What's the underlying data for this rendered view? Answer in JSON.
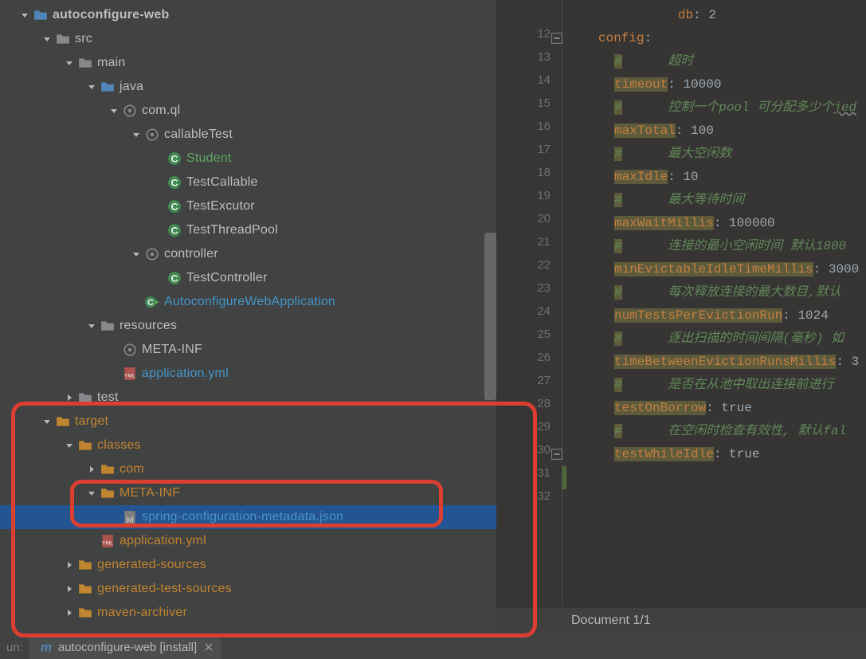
{
  "project": {
    "name": "autoconfigure-web",
    "tree": [
      {
        "d": 0,
        "open": true,
        "kind": "folder-b",
        "label": "autoconfigure-web",
        "style": "bold",
        "color": "normal"
      },
      {
        "d": 1,
        "open": true,
        "kind": "folder",
        "label": "src",
        "color": "normal"
      },
      {
        "d": 2,
        "open": true,
        "kind": "folder",
        "label": "main",
        "color": "normal"
      },
      {
        "d": 3,
        "open": true,
        "kind": "folder-b",
        "label": "java",
        "color": "normal"
      },
      {
        "d": 4,
        "open": true,
        "kind": "package",
        "label": "com.ql",
        "color": "normal"
      },
      {
        "d": 5,
        "open": true,
        "kind": "package",
        "label": "callableTest",
        "color": "normal"
      },
      {
        "d": 6,
        "leaf": true,
        "kind": "class",
        "label": "Student",
        "color": "green"
      },
      {
        "d": 6,
        "leaf": true,
        "kind": "class",
        "label": "TestCallable",
        "color": "normal"
      },
      {
        "d": 6,
        "leaf": true,
        "kind": "class",
        "label": "TestExcutor",
        "color": "normal"
      },
      {
        "d": 6,
        "leaf": true,
        "kind": "class",
        "label": "TestThreadPool",
        "color": "normal"
      },
      {
        "d": 5,
        "open": true,
        "kind": "package",
        "label": "controller",
        "color": "normal"
      },
      {
        "d": 6,
        "leaf": true,
        "kind": "class",
        "label": "TestController",
        "color": "normal"
      },
      {
        "d": 5,
        "leaf": true,
        "kind": "class-run",
        "label": "AutoconfigureWebApplication",
        "color": "blue"
      },
      {
        "d": 3,
        "open": true,
        "kind": "folder",
        "label": "resources",
        "color": "normal"
      },
      {
        "d": 4,
        "leaf": true,
        "kind": "package",
        "label": "META-INF",
        "color": "normal"
      },
      {
        "d": 4,
        "leaf": true,
        "kind": "yml",
        "label": "application.yml",
        "color": "blue"
      },
      {
        "d": 2,
        "open": false,
        "kind": "folder",
        "label": "test",
        "color": "normal"
      },
      {
        "d": 1,
        "open": true,
        "kind": "folder-o",
        "label": "target",
        "color": "orange"
      },
      {
        "d": 2,
        "open": true,
        "kind": "folder-o",
        "label": "classes",
        "color": "orange"
      },
      {
        "d": 3,
        "open": false,
        "kind": "folder-o",
        "label": "com",
        "color": "orange"
      },
      {
        "d": 3,
        "open": true,
        "kind": "folder-o",
        "label": "META-INF",
        "color": "orange"
      },
      {
        "d": 4,
        "leaf": true,
        "kind": "json",
        "label": "spring-configuration-metadata.json",
        "color": "blue",
        "sel": true
      },
      {
        "d": 3,
        "leaf": true,
        "kind": "yml",
        "label": "application.yml",
        "color": "orange"
      },
      {
        "d": 2,
        "open": false,
        "kind": "folder-o",
        "label": "generated-sources",
        "color": "orange"
      },
      {
        "d": 2,
        "open": false,
        "kind": "folder-o",
        "label": "generated-test-sources",
        "color": "orange"
      },
      {
        "d": 2,
        "open": false,
        "kind": "folder-o",
        "label": "maven-archiver",
        "color": "orange"
      }
    ]
  },
  "editor": {
    "first_line_no": 12,
    "gutter_icons": [
      {
        "line": 12,
        "kind": "collapse"
      },
      {
        "line": 30,
        "kind": "collapse"
      }
    ],
    "lines": [
      {
        "n": 0,
        "indent": 14,
        "tokens": [
          [
            "db",
            "key"
          ],
          [
            ": ",
            "val"
          ],
          [
            "2",
            "val"
          ]
        ],
        "partial_top": true
      },
      {
        "n": 12,
        "indent": 4,
        "tokens": [
          [
            "config",
            "key"
          ],
          [
            ":",
            "val"
          ]
        ]
      },
      {
        "n": 13,
        "indent": 6,
        "tokens": [
          [
            "#",
            "cmt-hi"
          ],
          [
            "      ",
            "cmt"
          ],
          [
            "超时",
            "cmt2"
          ]
        ]
      },
      {
        "n": 14,
        "indent": 6,
        "tokens": [
          [
            "timeout",
            "key-hi"
          ],
          [
            ": ",
            "val"
          ],
          [
            "10000",
            "val"
          ]
        ]
      },
      {
        "n": 15,
        "indent": 6,
        "tokens": [
          [
            "#",
            "cmt-hi"
          ],
          [
            "      ",
            "cmt"
          ],
          [
            "控制一个pool 可分配多少个",
            "cmt2"
          ],
          [
            "jed",
            "cmt-ul"
          ]
        ]
      },
      {
        "n": 16,
        "indent": 6,
        "tokens": [
          [
            "maxTotal",
            "key-hi"
          ],
          [
            ": ",
            "val"
          ],
          [
            "100",
            "val"
          ]
        ]
      },
      {
        "n": 17,
        "indent": 6,
        "tokens": [
          [
            "#",
            "cmt-hi"
          ],
          [
            "      ",
            "cmt"
          ],
          [
            "最大空闲数",
            "cmt2"
          ]
        ]
      },
      {
        "n": 18,
        "indent": 6,
        "tokens": [
          [
            "maxIdle",
            "key-hi"
          ],
          [
            ": ",
            "val"
          ],
          [
            "10",
            "val"
          ]
        ]
      },
      {
        "n": 19,
        "indent": 6,
        "tokens": [
          [
            "#",
            "cmt-hi"
          ],
          [
            "      ",
            "cmt"
          ],
          [
            "最大等待时间",
            "cmt2"
          ]
        ]
      },
      {
        "n": 20,
        "indent": 6,
        "tokens": [
          [
            "maxWaitMillis",
            "key-hi"
          ],
          [
            ": ",
            "val"
          ],
          [
            "100000",
            "val"
          ]
        ]
      },
      {
        "n": 21,
        "indent": 6,
        "tokens": [
          [
            "#",
            "cmt-hi"
          ],
          [
            "      ",
            "cmt"
          ],
          [
            "连接的最小空闲时间 默认1800",
            "cmt2"
          ]
        ]
      },
      {
        "n": 22,
        "indent": 6,
        "tokens": [
          [
            "minEvictableIdleTimeMillis",
            "key-hi"
          ],
          [
            ": ",
            "val"
          ],
          [
            "3000",
            "val"
          ]
        ]
      },
      {
        "n": 23,
        "indent": 6,
        "tokens": [
          [
            "#",
            "cmt-hi"
          ],
          [
            "      ",
            "cmt"
          ],
          [
            "每次释放连接的最大数目,默认",
            "cmt2"
          ]
        ]
      },
      {
        "n": 24,
        "indent": 6,
        "tokens": [
          [
            "numTestsPerEvictionRun",
            "key-hi"
          ],
          [
            ": ",
            "val"
          ],
          [
            "1024",
            "val"
          ]
        ]
      },
      {
        "n": 25,
        "indent": 6,
        "tokens": [
          [
            "#",
            "cmt-hi"
          ],
          [
            "      ",
            "cmt"
          ],
          [
            "逐出扫描的时间间隔(毫秒) 如",
            "cmt2"
          ]
        ]
      },
      {
        "n": 26,
        "indent": 6,
        "tokens": [
          [
            "timeBetweenEvictionRunsMillis",
            "key-hi"
          ],
          [
            ": ",
            "val"
          ],
          [
            "3",
            "val"
          ]
        ]
      },
      {
        "n": 27,
        "indent": 6,
        "tokens": [
          [
            "#",
            "cmt-hi"
          ],
          [
            "      ",
            "cmt"
          ],
          [
            "是否在从池中取出连接前进行",
            "cmt2"
          ]
        ]
      },
      {
        "n": 28,
        "indent": 6,
        "tokens": [
          [
            "testOnBorrow",
            "key-hi"
          ],
          [
            ": ",
            "val"
          ],
          [
            "true",
            "val"
          ]
        ]
      },
      {
        "n": 29,
        "indent": 6,
        "tokens": [
          [
            "#",
            "cmt-hi"
          ],
          [
            "      ",
            "cmt"
          ],
          [
            "在空闲时检查有效性, 默认fal",
            "cmt2"
          ]
        ]
      },
      {
        "n": 30,
        "indent": 6,
        "tokens": [
          [
            "testWhileIdle",
            "key-hi"
          ],
          [
            ": ",
            "val"
          ],
          [
            "true",
            "val"
          ]
        ]
      },
      {
        "n": 31,
        "indent": 0,
        "tokens": [],
        "current": true,
        "diff": "add"
      },
      {
        "n": 32,
        "indent": 0,
        "tokens": []
      }
    ]
  },
  "status": {
    "doc": "Document 1/1"
  },
  "runbar": {
    "label": "un:",
    "tab": "autoconfigure-web [install]"
  }
}
